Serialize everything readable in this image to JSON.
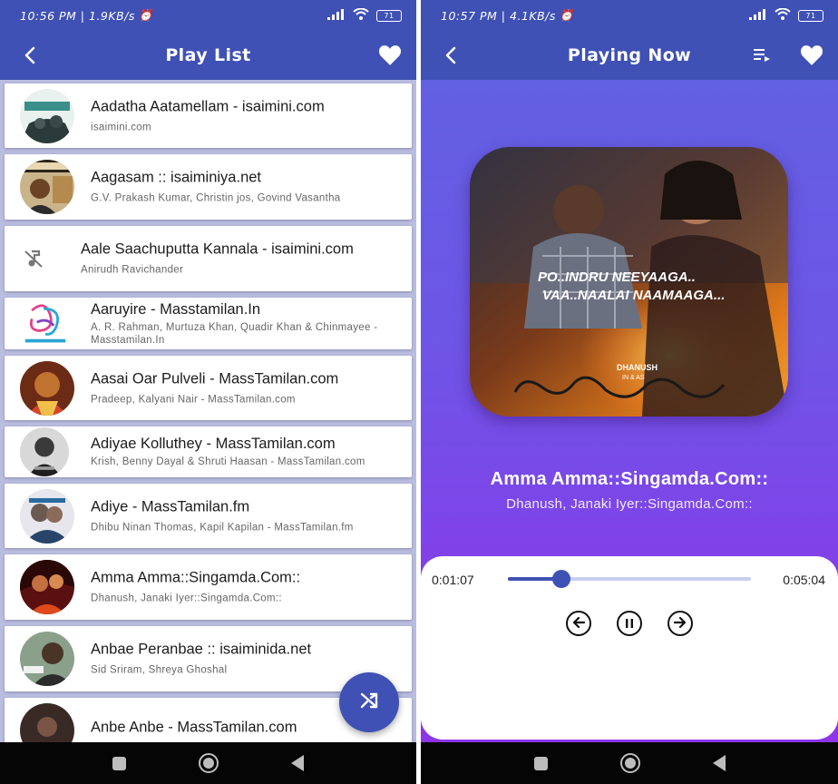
{
  "left": {
    "status": {
      "time": "10:56 PM",
      "speed": "1.9KB/s",
      "battery": "71"
    },
    "appbar": {
      "title": "Play List",
      "back_icon": "back-arrow-icon",
      "fav_icon": "heart-icon"
    },
    "songs": [
      {
        "title": "Aadatha Aatamellam - isaimini.com",
        "subtitle": "isaimini.com"
      },
      {
        "title": "Aagasam :: isaiminiya.net",
        "subtitle": "G.V. Prakash Kumar, Christin jos, Govind Vasantha"
      },
      {
        "title": "Aale Saachuputta Kannala - isaimini.com",
        "subtitle": "Anirudh Ravichander"
      },
      {
        "title": "Aaruyire - Masstamilan.In",
        "subtitle": "A. R. Rahman, Murtuza Khan, Quadir Khan & Chinmayee - Masstamilan.In"
      },
      {
        "title": "Aasai Oar Pulveli - MassTamilan.com",
        "subtitle": "Pradeep, Kalyani Nair - MassTamilan.com"
      },
      {
        "title": "Adiyae Kolluthey - MassTamilan.com",
        "subtitle": "Krish, Benny Dayal & Shruti Haasan - MassTamilan.com"
      },
      {
        "title": "Adiye - MassTamilan.fm",
        "subtitle": "Dhibu Ninan Thomas, Kapil Kapilan - MassTamilan.fm"
      },
      {
        "title": "Amma Amma::Singamda.Com::",
        "subtitle": "Dhanush, Janaki Iyer::Singamda.Com::"
      },
      {
        "title": "Anbae Peranbae :: isaiminida.net",
        "subtitle": "Sid Sriram, Shreya Ghoshal"
      },
      {
        "title": "Anbe Anbe - MassTamilan.com",
        "subtitle": ""
      }
    ],
    "fab_icon": "shuffle-icon"
  },
  "right": {
    "status": {
      "time": "10:57 PM",
      "speed": "4.1KB/s",
      "battery": "71"
    },
    "appbar": {
      "title": "Playing Now",
      "back_icon": "back-arrow-icon",
      "queue_icon": "playlist-icon",
      "fav_icon": "heart-icon"
    },
    "art": {
      "line1": "PO..INDRU NEEYAAGA..",
      "line2": "VAA..NAALAI NAAMAAGA...",
      "credit1": "DHANUSH",
      "credit2": "IN & AS"
    },
    "now_playing": {
      "title": "Amma Amma::Singamda.Com::",
      "artist": "Dhanush, Janaki Iyer::Singamda.Com::"
    },
    "player": {
      "elapsed": "0:01:07",
      "duration": "0:05:04",
      "progress": 0.22
    }
  },
  "colors": {
    "primary": "#3f51b5",
    "gradient_start": "#5f63e0",
    "gradient_end": "#8f33ea"
  }
}
